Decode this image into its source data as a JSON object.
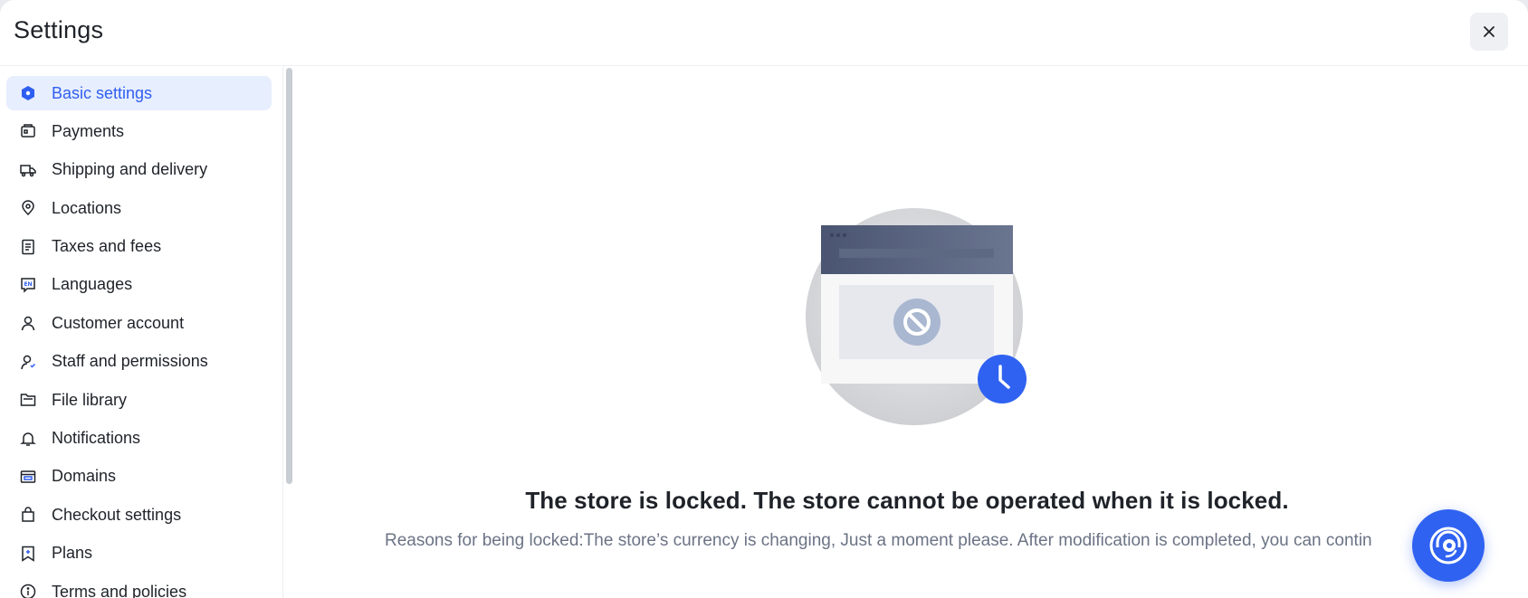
{
  "header": {
    "title": "Settings"
  },
  "sidebar": {
    "items": [
      {
        "label": "Basic settings",
        "icon": "hexagon-icon",
        "active": true
      },
      {
        "label": "Payments",
        "icon": "wallet-icon"
      },
      {
        "label": "Shipping and delivery",
        "icon": "truck-icon"
      },
      {
        "label": "Locations",
        "icon": "location-pin-icon"
      },
      {
        "label": "Taxes and fees",
        "icon": "receipt-icon"
      },
      {
        "label": "Languages",
        "icon": "language-en-icon"
      },
      {
        "label": "Customer account",
        "icon": "user-icon"
      },
      {
        "label": "Staff and permissions",
        "icon": "user-permission-icon"
      },
      {
        "label": "File library",
        "icon": "folder-icon"
      },
      {
        "label": "Notifications",
        "icon": "bell-icon"
      },
      {
        "label": "Domains",
        "icon": "domain-icon"
      },
      {
        "label": "Checkout settings",
        "icon": "shopping-bag-icon"
      },
      {
        "label": "Plans",
        "icon": "plan-bookmark-icon"
      },
      {
        "label": "Terms and policies",
        "icon": "info-icon"
      }
    ]
  },
  "main": {
    "headline": "The store is locked. The store cannot be operated when it is locked.",
    "reason": "Reasons for being locked:The store’s currency is changing, Just a moment please. After modification is completed, you can contin"
  },
  "colors": {
    "accent": "#2f5ff0",
    "active_bg": "#e7eefe",
    "text": "#1f2329",
    "muted": "#6b7385"
  }
}
